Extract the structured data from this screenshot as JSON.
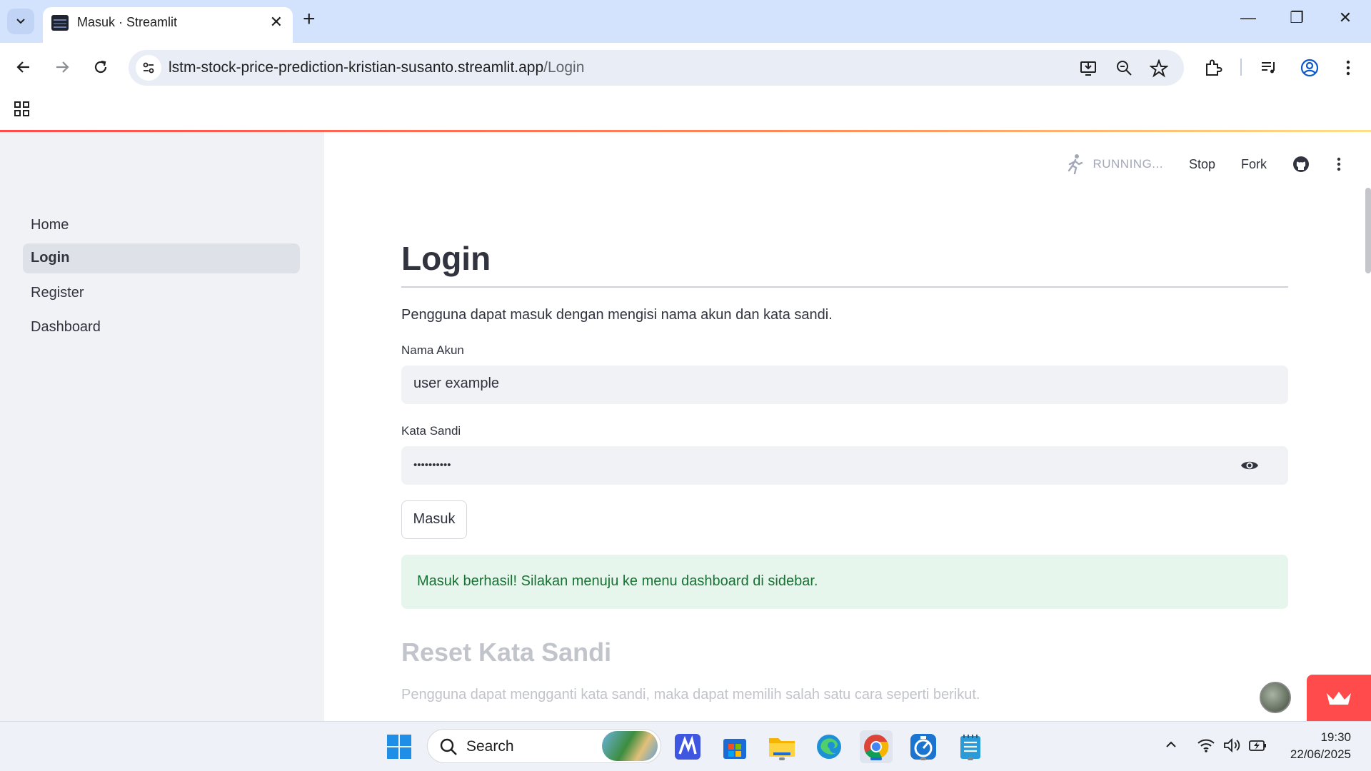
{
  "browser": {
    "tab_title": "Masuk · Streamlit",
    "url_host": "lstm-stock-price-prediction-kristian-susanto.streamlit.app",
    "url_path": "/Login"
  },
  "header": {
    "status": "RUNNING...",
    "stop_label": "Stop",
    "fork_label": "Fork"
  },
  "sidebar": {
    "items": [
      {
        "label": "Home"
      },
      {
        "label": "Login"
      },
      {
        "label": "Register"
      },
      {
        "label": "Dashboard"
      }
    ],
    "active_item": "Login"
  },
  "main": {
    "title": "Login",
    "description": "Pengguna dapat masuk dengan mengisi nama akun dan kata sandi.",
    "username_label": "Nama Akun",
    "username_value": "user example",
    "password_label": "Kata Sandi",
    "password_value": "••••••••••",
    "submit_label": "Masuk",
    "success_message": "Masuk berhasil! Silakan menuju ke menu dashboard di sidebar.",
    "reset_title": "Reset Kata Sandi",
    "reset_description": "Pengguna dapat mengganti kata sandi, maka dapat memilih salah satu cara seperti berikut."
  },
  "taskbar": {
    "search_label": "Search",
    "time": "19:30",
    "date": "22/06/2025"
  },
  "colors": {
    "accent": "#ff4b4b",
    "sidebar_bg": "#f0f2f6",
    "success_bg": "#e7f6ec",
    "success_text": "#177233"
  }
}
